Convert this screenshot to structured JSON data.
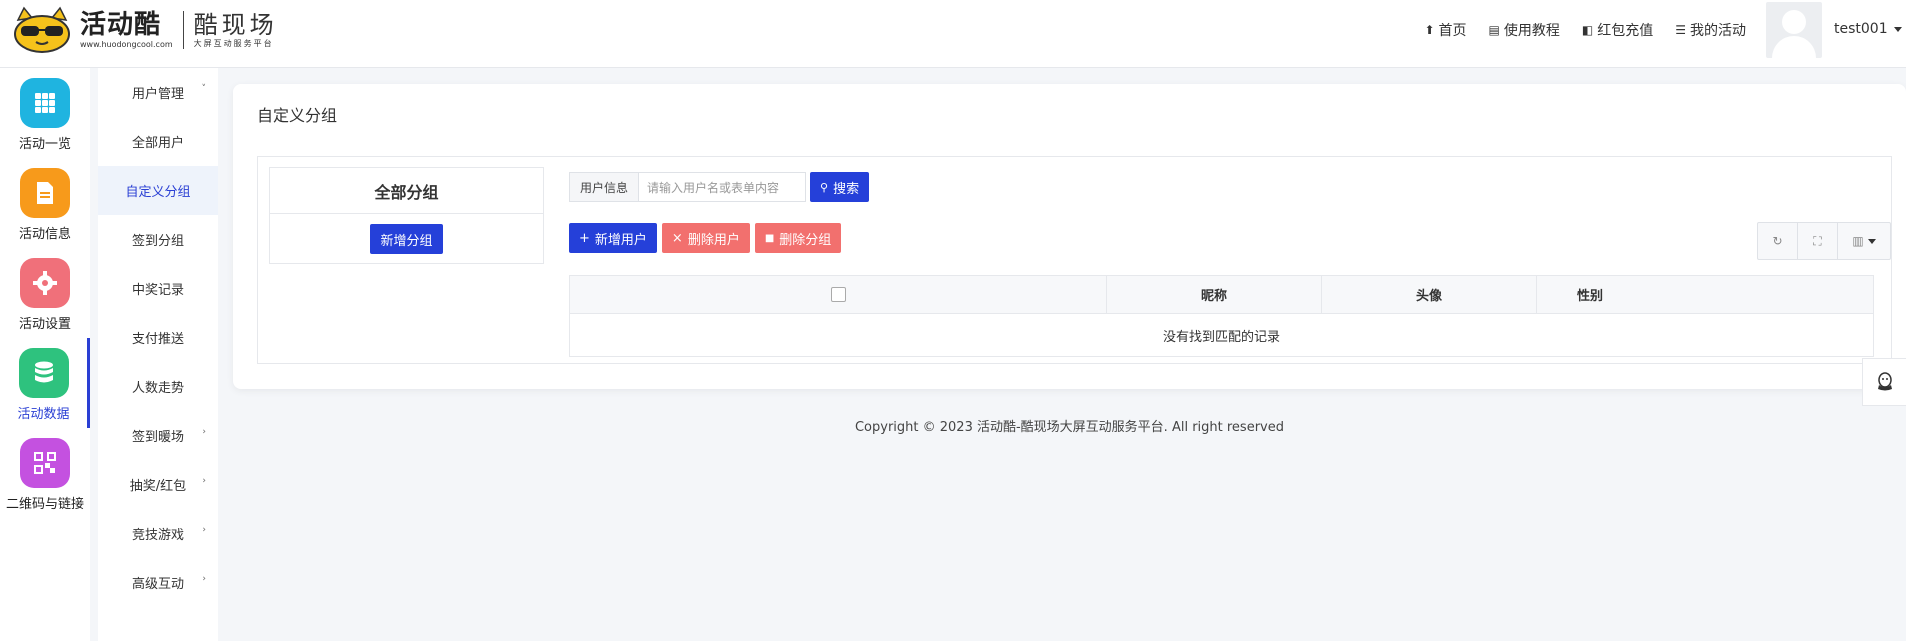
{
  "header": {
    "logo_main": "活动酷",
    "logo_url": "www.huodongcool.com",
    "logo_sub_main": "酷现场",
    "logo_sub_small": "大屏互动服务平台",
    "nav": [
      {
        "label": "首页",
        "icon": "home-icon"
      },
      {
        "label": "使用教程",
        "icon": "document-icon"
      },
      {
        "label": "红包充值",
        "icon": "wallet-icon"
      },
      {
        "label": "我的活动",
        "icon": "list-icon"
      }
    ],
    "username": "test001"
  },
  "iconbar": {
    "items": [
      {
        "label": "活动一览",
        "icon": "grid-icon",
        "color": "#1fb4e0"
      },
      {
        "label": "活动信息",
        "icon": "file-icon",
        "color": "#f79a1b"
      },
      {
        "label": "活动设置",
        "icon": "gear-icon",
        "color": "#f0707a"
      },
      {
        "label": "活动数据",
        "icon": "database-icon",
        "color": "#2ec27e"
      },
      {
        "label": "二维码与链接",
        "icon": "qrcode-icon",
        "color": "#c451e0"
      }
    ]
  },
  "submenu": {
    "items": [
      {
        "label": "用户管理",
        "chevron": "˅"
      },
      {
        "label": "全部用户",
        "chevron": ""
      },
      {
        "label": "自定义分组",
        "chevron": ""
      },
      {
        "label": "签到分组",
        "chevron": ""
      },
      {
        "label": "中奖记录",
        "chevron": ""
      },
      {
        "label": "支付推送",
        "chevron": ""
      },
      {
        "label": "人数走势",
        "chevron": ""
      },
      {
        "label": "签到暖场",
        "chevron": "›"
      },
      {
        "label": "抽奖/红包",
        "chevron": "›"
      },
      {
        "label": "竞技游戏",
        "chevron": "›"
      },
      {
        "label": "高级互动",
        "chevron": "›"
      }
    ]
  },
  "main": {
    "title": "自定义分组",
    "group_panel": {
      "title": "全部分组",
      "add_button": "新增分组"
    },
    "search": {
      "label": "用户信息",
      "placeholder": "请输入用户名或表单内容",
      "button": "搜索"
    },
    "actions": {
      "add_user": "新增用户",
      "delete_user": "删除用户",
      "delete_group": "删除分组"
    },
    "table": {
      "columns": [
        "",
        "昵称",
        "头像",
        "性别"
      ],
      "empty_text": "没有找到匹配的记录"
    }
  },
  "footer": {
    "text": "Copyright © 2023 活动酷-酷现场大屏互动服务平台. All right reserved"
  },
  "colors": {
    "primary": "#2540d9",
    "danger": "#f2706e",
    "active_menu_bg": "#eef3fb"
  }
}
